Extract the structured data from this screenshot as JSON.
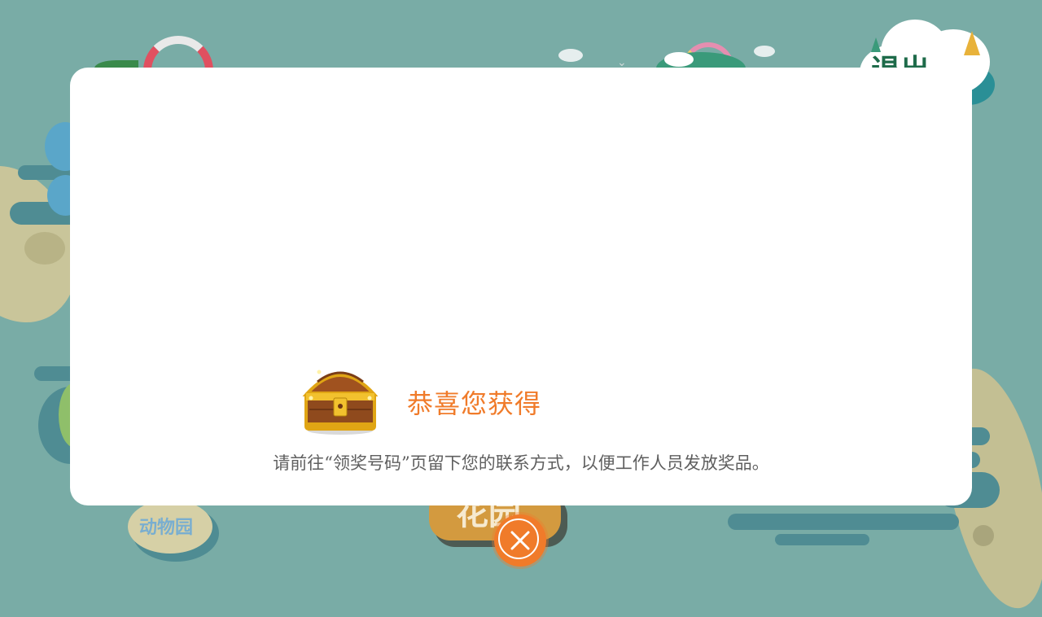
{
  "background": {
    "exit_label": "退出",
    "zoo_label": "动物园",
    "garden_label": "花园"
  },
  "modal": {
    "title": "恭喜您获得",
    "message": "请前往“领奖号码”页留下您的联系方式，以便工作人员发放奖品。",
    "chest_icon": "treasure-chest-icon",
    "close_icon": "close-icon"
  },
  "colors": {
    "background": "#79aca6",
    "accent": "#f07b2a",
    "modal_bg": "#ffffff"
  }
}
